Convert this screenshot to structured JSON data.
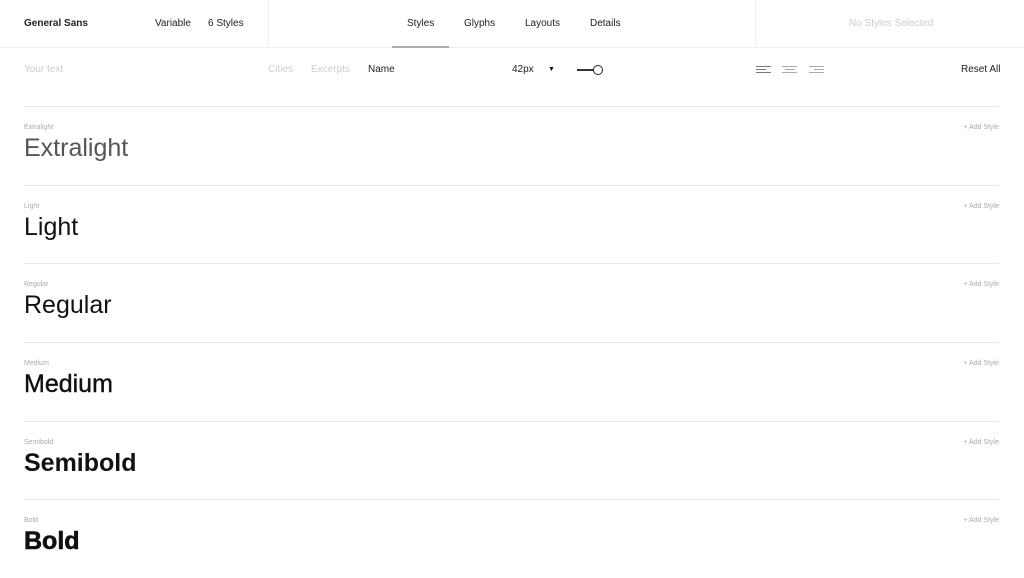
{
  "header": {
    "font_name": "General Sans",
    "variable": "Variable",
    "styles_count": "6 Styles",
    "tabs": [
      "Styles",
      "Glyphs",
      "Layouts",
      "Details"
    ],
    "active_tab": "Styles",
    "selection_status": "No Styles Selected"
  },
  "toolbar": {
    "text_placeholder": "Your text",
    "presets": [
      "Cities",
      "Excerpts",
      "Name"
    ],
    "active_preset": "Name",
    "size": "42px",
    "reset": "Reset All"
  },
  "rows": [
    {
      "label": "Extralight",
      "sample": "Extralight",
      "weight": 200,
      "add": "+ Add Style"
    },
    {
      "label": "Light",
      "sample": "Light",
      "weight": 300,
      "add": "+ Add Style"
    },
    {
      "label": "Regular",
      "sample": "Regular",
      "weight": 400,
      "add": "+ Add Style"
    },
    {
      "label": "Medium",
      "sample": "Medium",
      "weight": 500,
      "add": "+ Add Style"
    },
    {
      "label": "Semibold",
      "sample": "Semibold",
      "weight": 600,
      "add": "+ Add Style"
    },
    {
      "label": "Bold",
      "sample": "Bold",
      "weight": 700,
      "add": "+ Add Style"
    }
  ]
}
